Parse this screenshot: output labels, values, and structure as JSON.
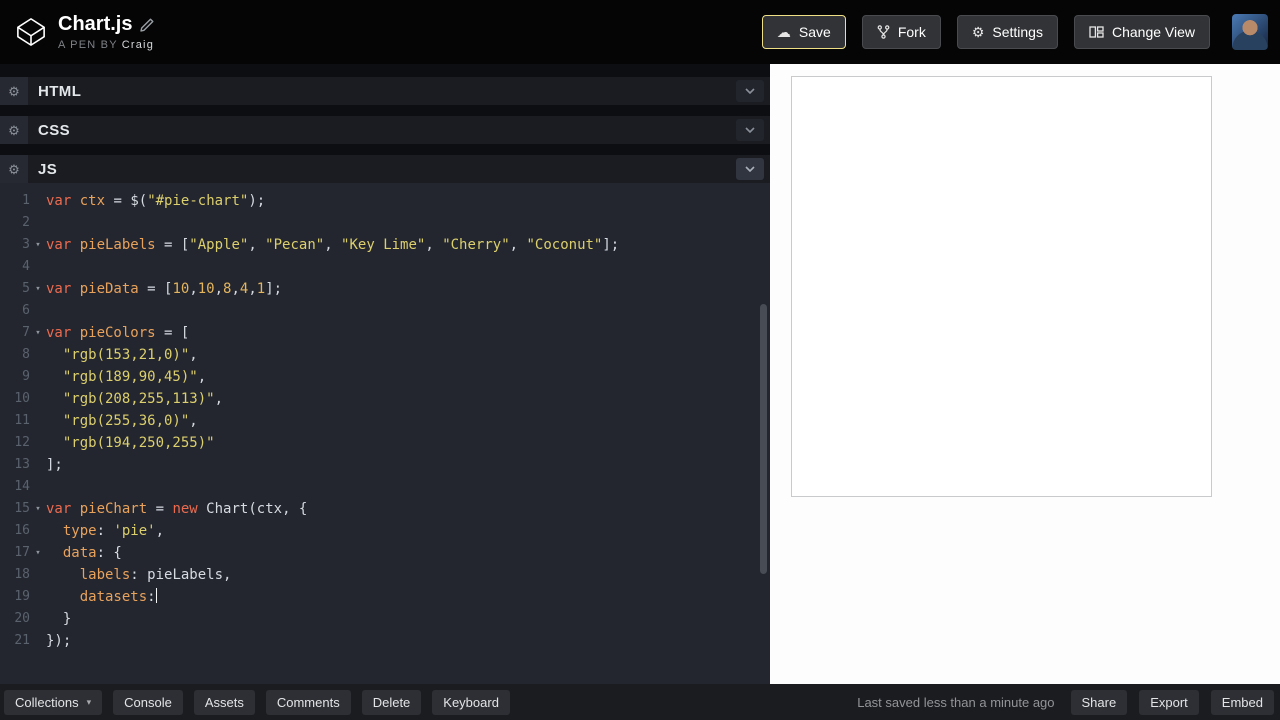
{
  "colors": {
    "accent_save_border": "#efe086",
    "kw": "#ec6b50",
    "ident": "#e9a25c",
    "string": "#dccf6d",
    "number": "#e3b55f",
    "punct": "#d6dae1",
    "gutter": "#5a626e"
  },
  "icons": {
    "cloud": "☁",
    "gear": "⚙",
    "caret_down": "▾",
    "fold": "▾"
  },
  "header": {
    "title": "Chart.js",
    "byline_prefix": "A PEN BY",
    "author": "Craig",
    "save_label": "Save",
    "fork_label": "Fork",
    "settings_label": "Settings",
    "change_view_label": "Change View"
  },
  "panels": {
    "html_label": "HTML",
    "css_label": "CSS",
    "js_label": "JS"
  },
  "code": {
    "lines": [
      {
        "n": 1,
        "tokens": [
          [
            "kw",
            "var "
          ],
          [
            "id",
            "ctx"
          ],
          [
            "pun",
            " = "
          ],
          [
            "plain",
            "$"
          ],
          [
            "pun",
            "("
          ],
          [
            "str",
            "\"#pie-chart\""
          ],
          [
            "pun",
            ");"
          ]
        ]
      },
      {
        "n": 2,
        "tokens": []
      },
      {
        "n": 3,
        "fold": true,
        "tokens": [
          [
            "kw",
            "var "
          ],
          [
            "id",
            "pieLabels"
          ],
          [
            "pun",
            " = ["
          ],
          [
            "str",
            "\"Apple\""
          ],
          [
            "pun",
            ", "
          ],
          [
            "str",
            "\"Pecan\""
          ],
          [
            "pun",
            ", "
          ],
          [
            "str",
            "\"Key Lime\""
          ],
          [
            "pun",
            ", "
          ],
          [
            "str",
            "\"Cherry\""
          ],
          [
            "pun",
            ", "
          ],
          [
            "str",
            "\"Coconut\""
          ],
          [
            "pun",
            "];"
          ]
        ]
      },
      {
        "n": 4,
        "tokens": []
      },
      {
        "n": 5,
        "fold": true,
        "tokens": [
          [
            "kw",
            "var "
          ],
          [
            "id",
            "pieData"
          ],
          [
            "pun",
            " = ["
          ],
          [
            "num",
            "10"
          ],
          [
            "pun",
            ","
          ],
          [
            "num",
            "10"
          ],
          [
            "pun",
            ","
          ],
          [
            "num",
            "8"
          ],
          [
            "pun",
            ","
          ],
          [
            "num",
            "4"
          ],
          [
            "pun",
            ","
          ],
          [
            "num",
            "1"
          ],
          [
            "pun",
            "];"
          ]
        ]
      },
      {
        "n": 6,
        "tokens": []
      },
      {
        "n": 7,
        "fold": true,
        "tokens": [
          [
            "kw",
            "var "
          ],
          [
            "id",
            "pieColors"
          ],
          [
            "pun",
            " = ["
          ]
        ]
      },
      {
        "n": 8,
        "tokens": [
          [
            "pun",
            "  "
          ],
          [
            "str",
            "\"rgb(153,21,0)\""
          ],
          [
            "pun",
            ","
          ]
        ]
      },
      {
        "n": 9,
        "tokens": [
          [
            "pun",
            "  "
          ],
          [
            "str",
            "\"rgb(189,90,45)\""
          ],
          [
            "pun",
            ","
          ]
        ]
      },
      {
        "n": 10,
        "tokens": [
          [
            "pun",
            "  "
          ],
          [
            "str",
            "\"rgb(208,255,113)\""
          ],
          [
            "pun",
            ","
          ]
        ]
      },
      {
        "n": 11,
        "tokens": [
          [
            "pun",
            "  "
          ],
          [
            "str",
            "\"rgb(255,36,0)\""
          ],
          [
            "pun",
            ","
          ]
        ]
      },
      {
        "n": 12,
        "tokens": [
          [
            "pun",
            "  "
          ],
          [
            "str",
            "\"rgb(194,250,255)\""
          ]
        ]
      },
      {
        "n": 13,
        "tokens": [
          [
            "pun",
            "];"
          ]
        ]
      },
      {
        "n": 14,
        "tokens": []
      },
      {
        "n": 15,
        "fold": true,
        "tokens": [
          [
            "kw",
            "var "
          ],
          [
            "id",
            "pieChart"
          ],
          [
            "pun",
            " = "
          ],
          [
            "kw",
            "new "
          ],
          [
            "plain",
            "Chart"
          ],
          [
            "pun",
            "("
          ],
          [
            "plain",
            "ctx"
          ],
          [
            "pun",
            ", {"
          ]
        ]
      },
      {
        "n": 16,
        "tokens": [
          [
            "pun",
            "  "
          ],
          [
            "prop",
            "type"
          ],
          [
            "pun",
            ": "
          ],
          [
            "str",
            "'pie'"
          ],
          [
            "pun",
            ","
          ]
        ]
      },
      {
        "n": 17,
        "fold": true,
        "tokens": [
          [
            "pun",
            "  "
          ],
          [
            "prop",
            "data"
          ],
          [
            "pun",
            ": {"
          ]
        ]
      },
      {
        "n": 18,
        "tokens": [
          [
            "pun",
            "    "
          ],
          [
            "prop",
            "labels"
          ],
          [
            "pun",
            ": "
          ],
          [
            "plain",
            "pieLabels"
          ],
          [
            "pun",
            ","
          ]
        ]
      },
      {
        "n": 19,
        "cursor": true,
        "tokens": [
          [
            "pun",
            "    "
          ],
          [
            "prop",
            "datasets"
          ],
          [
            "pun",
            ":"
          ]
        ]
      },
      {
        "n": 20,
        "tokens": [
          [
            "pun",
            "  }"
          ]
        ]
      },
      {
        "n": 21,
        "tokens": [
          [
            "pun",
            "});"
          ]
        ]
      }
    ]
  },
  "footer": {
    "collections_label": "Collections",
    "console_label": "Console",
    "assets_label": "Assets",
    "comments_label": "Comments",
    "delete_label": "Delete",
    "keyboard_label": "Keyboard",
    "status": "Last saved less than a minute ago",
    "share_label": "Share",
    "export_label": "Export",
    "embed_label": "Embed"
  }
}
